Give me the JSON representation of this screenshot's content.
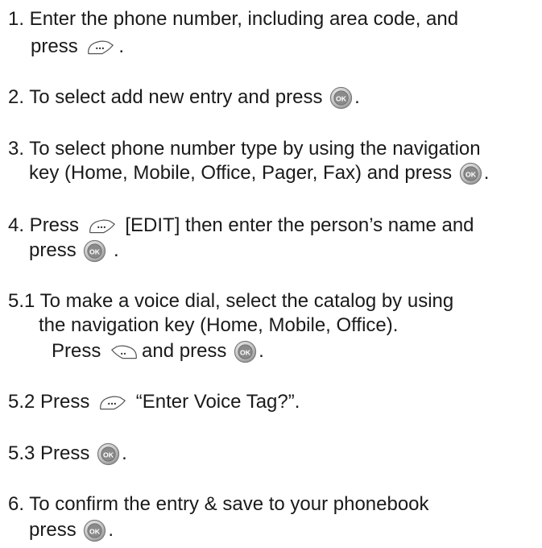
{
  "steps": {
    "s1": {
      "line1": "1. Enter the phone number, including area code, and",
      "line2_pre": "press",
      "line2_post": "."
    },
    "s2": {
      "pre": "2. To select add new entry and press",
      "post": "."
    },
    "s3": {
      "line1": "3. To select phone number type by using the navigation",
      "line2_pre": "key (Home, Mobile, Office, Pager, Fax) and press",
      "line2_post": "."
    },
    "s4": {
      "line1_pre": "4. Press",
      "line1_post": "[EDIT] then enter the person’s name and",
      "line2_pre": "press",
      "line2_post": "."
    },
    "s51": {
      "line1": "5.1 To make a voice dial, select the catalog by using",
      "line2": "the navigation key (Home, Mobile, Office).",
      "line3_pre": "Press",
      "line3_mid": "and press",
      "line3_post": "."
    },
    "s52": {
      "pre": "5.2 Press",
      "post": "“Enter Voice Tag?”."
    },
    "s53": {
      "pre": "5.3 Press",
      "post": "."
    },
    "s6": {
      "line1": "6. To confirm the entry & save to your phonebook",
      "line2_pre": "press",
      "line2_post": "."
    }
  },
  "icons": {
    "ok_label": "OK",
    "right_soft_key": "right-soft-key-icon",
    "left_soft_key": "left-soft-key-icon",
    "ok_key": "ok-key-icon",
    "colors": {
      "text": "#1a1a1a",
      "key_fill": "#d9d9d9",
      "key_stroke": "#6b6b6b"
    }
  }
}
